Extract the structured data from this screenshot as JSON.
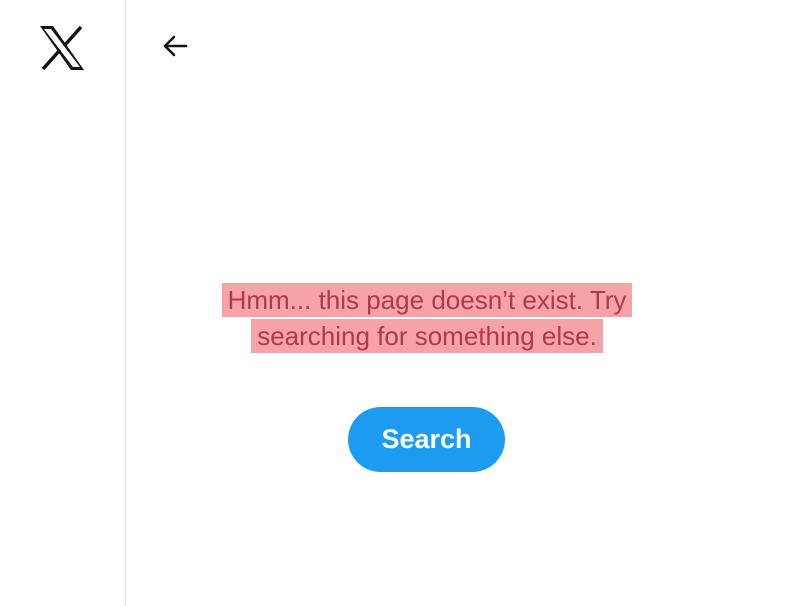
{
  "sidebar": {
    "logo_icon": "x-logo-icon"
  },
  "header": {
    "back_icon": "back-arrow-icon"
  },
  "main": {
    "message_line1": "Hmm... this page doesn’t exist. Try",
    "message_line2": "searching for something else.",
    "search_button_label": "Search"
  },
  "colors": {
    "accent": "#1d9bf0",
    "highlight": "#f6a3a8",
    "highlight_text": "#b03a45",
    "divider": "#e6e8ea"
  }
}
